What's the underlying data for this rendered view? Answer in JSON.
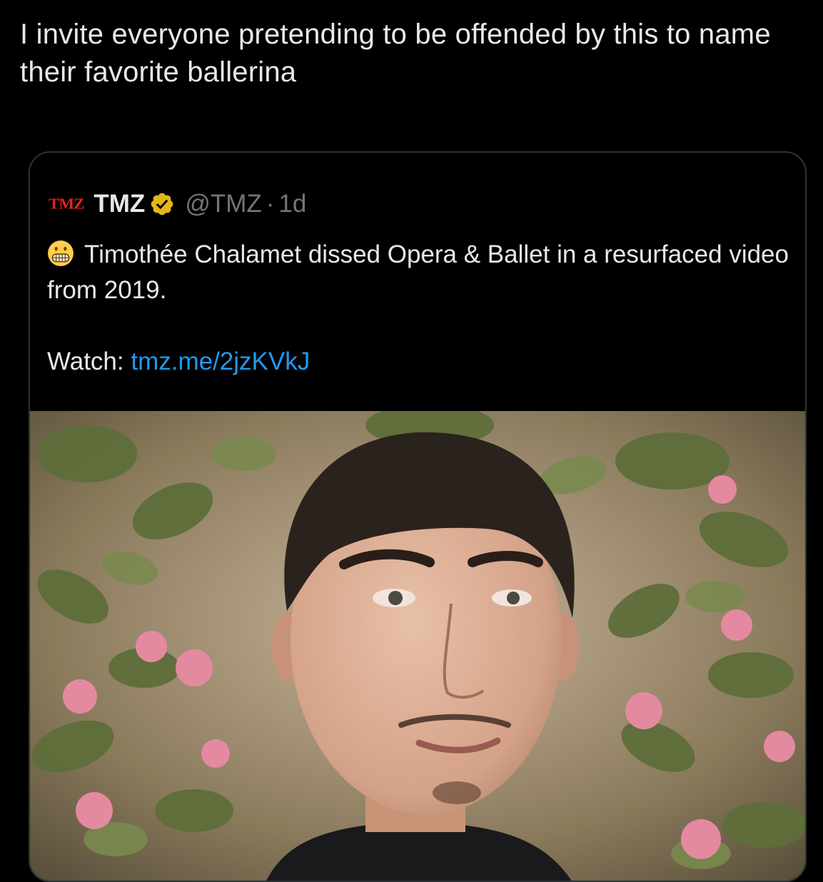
{
  "tweet": {
    "text": "I invite everyone pretending to be offended by this to name their favorite ballerina"
  },
  "quote": {
    "logo_text": "TMZ",
    "author_name": "TMZ",
    "verified_icon": "verified-badge-gold",
    "handle": "@TMZ",
    "separator": "·",
    "time": "1d",
    "emoji_icon": "grimacing-face-emoji",
    "text": "Timothée Chalamet dissed Opera & Ballet in a resurfaced video from 2019.",
    "watch_label": "Watch: ",
    "link_text": "tmz.me/2jzKVkJ",
    "media_alt": "Photo of a young man with short dark hair in front of green leaves and pink flowers"
  },
  "colors": {
    "background": "#000000",
    "text": "#e7e9ea",
    "secondary_text": "#71767b",
    "link": "#1d9bf0",
    "border": "#2f3336",
    "tmz_red": "#e0241b",
    "verified_gold": "#e2b719"
  }
}
